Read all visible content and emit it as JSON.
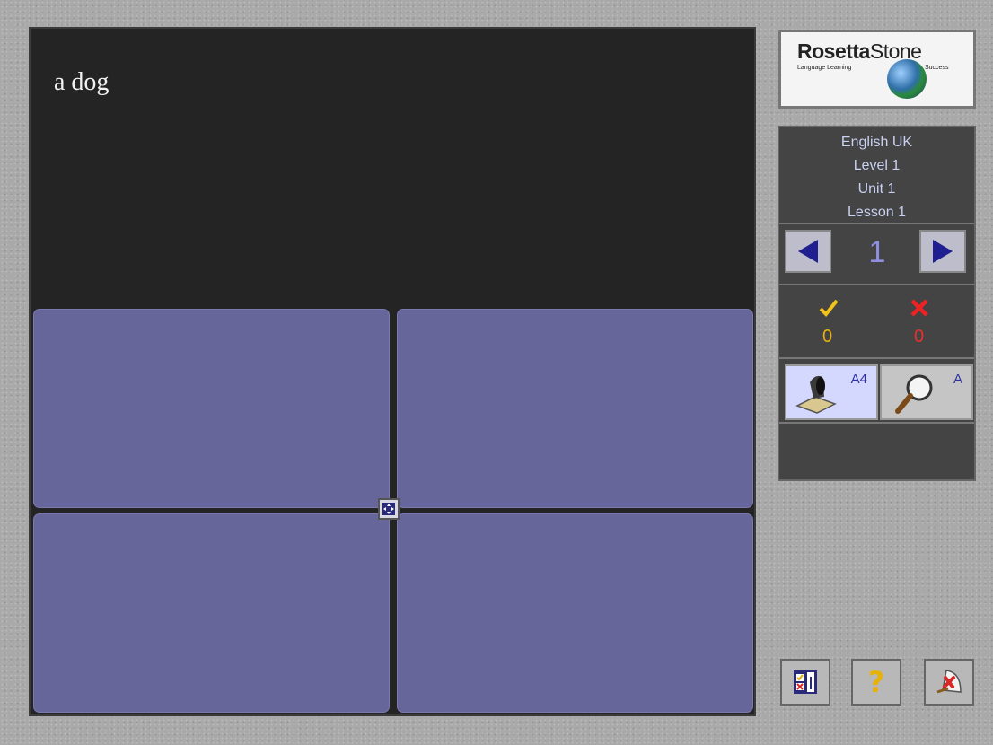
{
  "prompt": {
    "text": "a dog"
  },
  "logo": {
    "brand_bold": "Rosetta",
    "brand_light": "Stone",
    "tag_left": "Language Learning",
    "tag_right": "Success"
  },
  "lesson_info": {
    "language": "English UK",
    "level": "Level 1",
    "unit": "Unit 1",
    "lesson": "Lesson 1"
  },
  "navigation": {
    "page": "1"
  },
  "score": {
    "correct": "0",
    "wrong": "0"
  },
  "modes": [
    {
      "name": "listen-read",
      "label": "A4"
    },
    {
      "name": "read",
      "label": "A"
    }
  ],
  "icons": {
    "prev": "left-triangle-icon",
    "next": "right-triangle-icon",
    "correct": "checkmark-icon",
    "wrong": "x-icon",
    "listen": "speaker-icon",
    "read": "magnifier-icon",
    "center": "shuffle-icon",
    "results": "results-icon",
    "help": "help-icon",
    "exit": "exit-icon"
  },
  "bottom": {
    "help_glyph": "?"
  },
  "colors": {
    "tile": "#66669a",
    "stage": "#242424",
    "accent": "#1f1f8f",
    "correct": "#e8b00a",
    "wrong": "#e53030"
  }
}
